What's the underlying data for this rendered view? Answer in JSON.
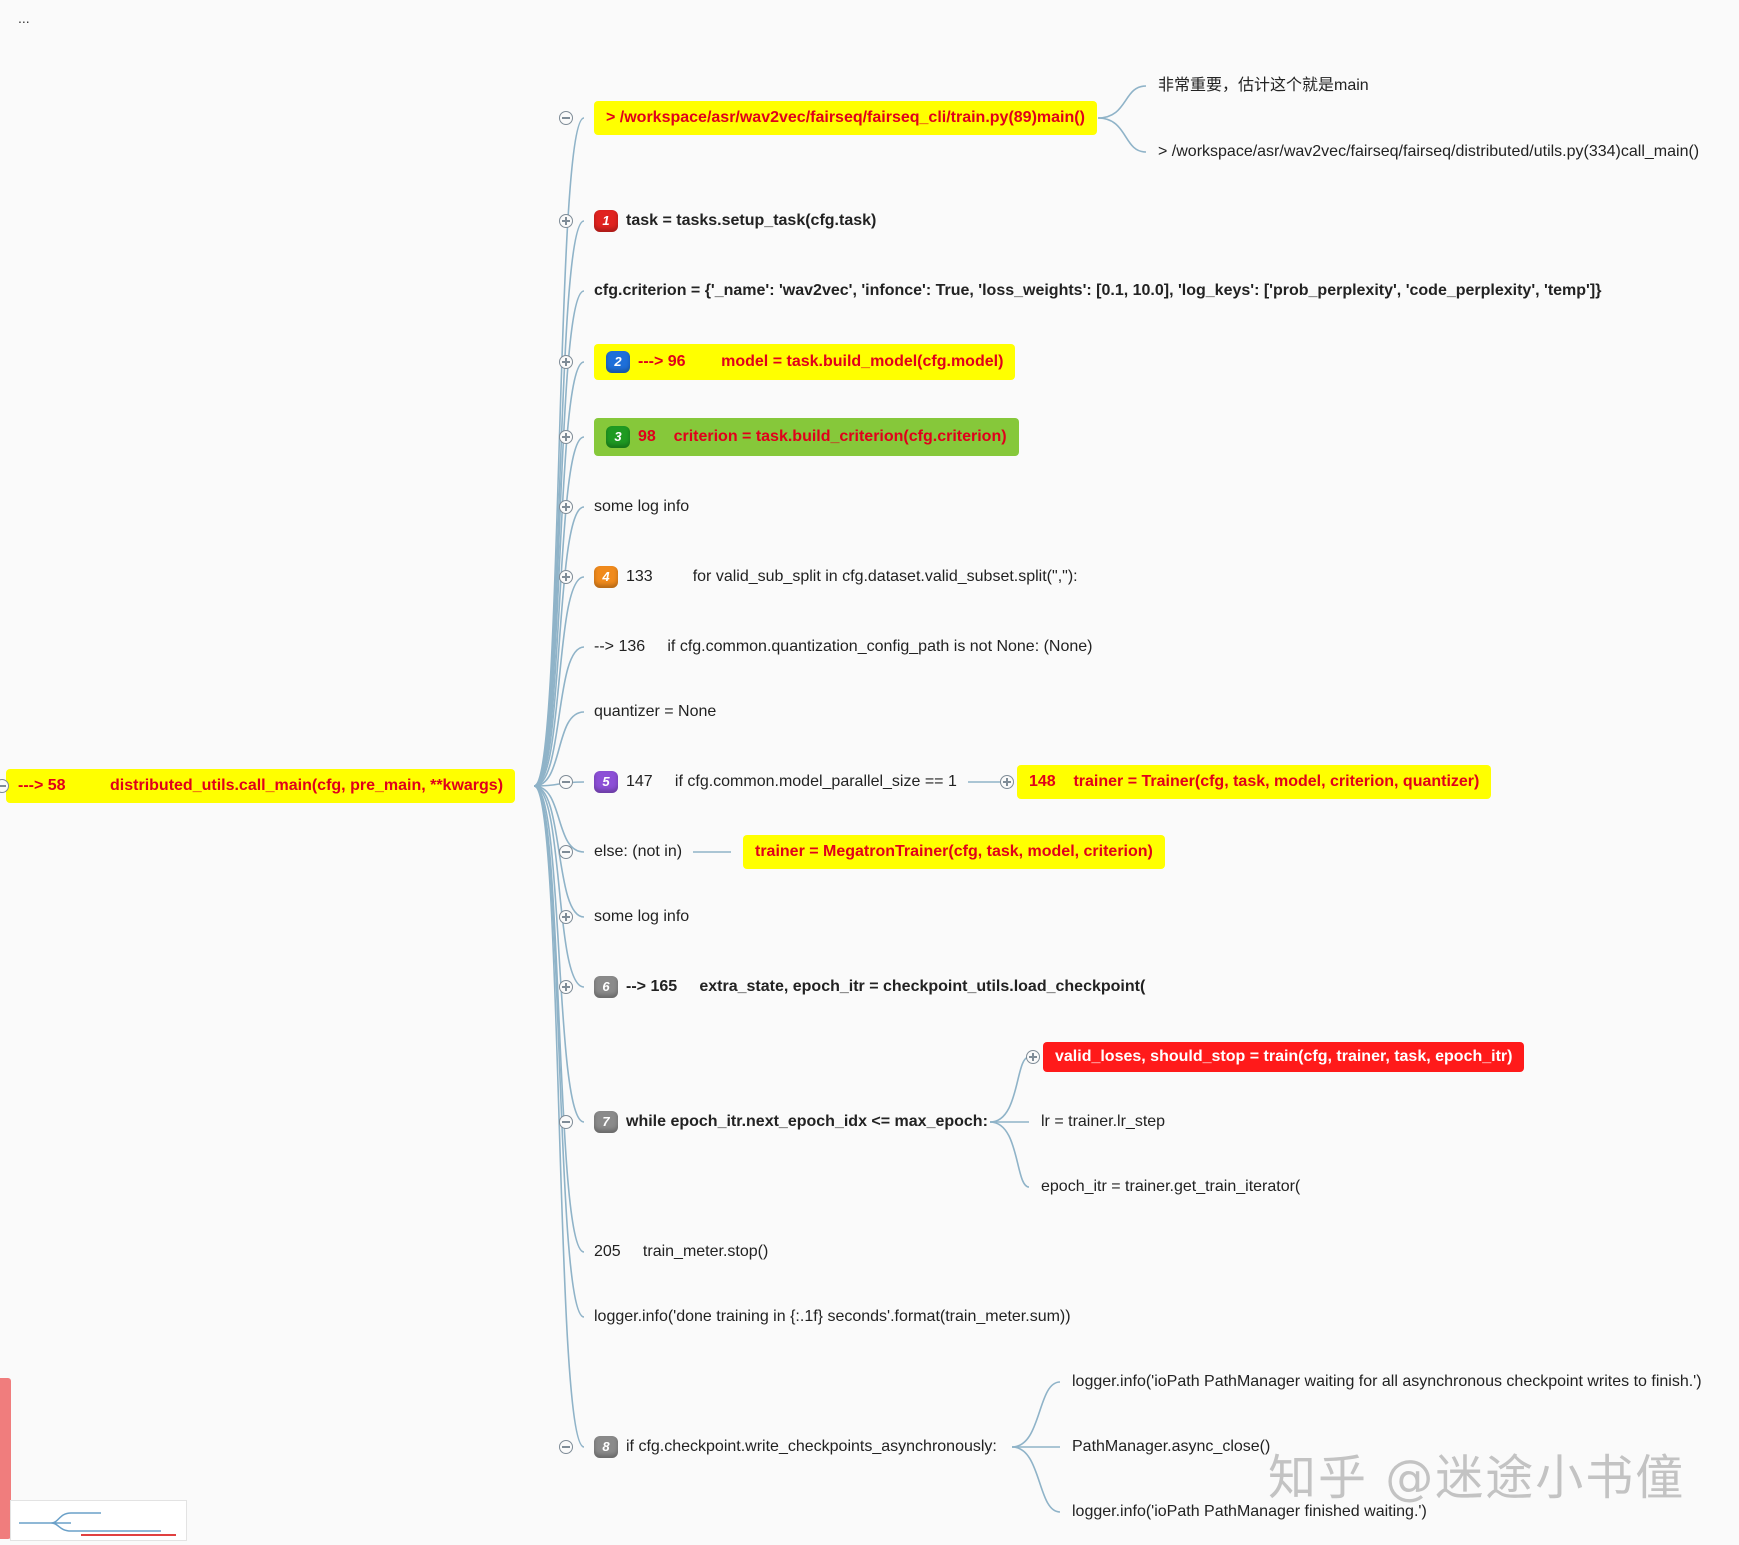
{
  "ellipsis": "...",
  "root": {
    "text": "---> 58          distributed_utils.call_main(cfg, pre_main, **kwargs)"
  },
  "branches": [
    {
      "id": "b0",
      "text": "> /workspace/asr/wav2vec/fairseq/fairseq_cli/train.py(89)main()",
      "style": "yellow",
      "toggle": "minus"
    },
    {
      "id": "b1",
      "badge": "1",
      "badge_color": "#e0231f",
      "text": "task = tasks.setup_task(cfg.task)",
      "style": "bold",
      "toggle": "plus"
    },
    {
      "id": "b2",
      "text": "cfg.criterion = {'_name': 'wav2vec', 'infonce': True, 'loss_weights': [0.1, 10.0], 'log_keys': ['prob_perplexity', 'code_perplexity', 'temp']}",
      "style": "bold",
      "toggle": "none"
    },
    {
      "id": "b3",
      "badge": "2",
      "badge_color": "#1e6fd9",
      "text": "---> 96        model = task.build_model(cfg.model)",
      "style": "yellow",
      "toggle": "plus"
    },
    {
      "id": "b4",
      "badge": "3",
      "badge_color": "#1f9a22",
      "text": "98    criterion = task.build_criterion(cfg.criterion)",
      "style": "green",
      "toggle": "plus"
    },
    {
      "id": "b5",
      "text": "some log info",
      "style": "plain",
      "toggle": "plus"
    },
    {
      "id": "b6",
      "badge": "4",
      "badge_color": "#f08a1c",
      "text": "133         for valid_sub_split in cfg.dataset.valid_subset.split(\",\"):",
      "style": "plain",
      "toggle": "plus"
    },
    {
      "id": "b7",
      "text": "--> 136     if cfg.common.quantization_config_path is not None: (None)",
      "style": "plain",
      "toggle": "none"
    },
    {
      "id": "b8",
      "text": "quantizer = None",
      "style": "plain",
      "toggle": "none"
    },
    {
      "id": "b9",
      "badge": "5",
      "badge_color": "#8c4fd6",
      "text": "147     if cfg.common.model_parallel_size == 1",
      "style": "plain",
      "toggle": "minus"
    },
    {
      "id": "b10",
      "text": "else: (not in)",
      "style": "plain",
      "toggle": "minus"
    },
    {
      "id": "b11",
      "text": "some log info",
      "style": "plain",
      "toggle": "plus"
    },
    {
      "id": "b12",
      "badge": "6",
      "badge_color": "#8a8a8a",
      "text": "--> 165     extra_state, epoch_itr = checkpoint_utils.load_checkpoint(",
      "style": "bold",
      "toggle": "plus"
    },
    {
      "id": "b13",
      "badge": "7",
      "badge_color": "#8a8a8a",
      "text": "while epoch_itr.next_epoch_idx <= max_epoch:",
      "style": "bold",
      "toggle": "minus"
    },
    {
      "id": "b14",
      "text": "205     train_meter.stop()",
      "style": "plain",
      "toggle": "none"
    },
    {
      "id": "b15",
      "text": "logger.info('done training in {:.1f} seconds'.format(train_meter.sum))",
      "style": "plain",
      "toggle": "none"
    },
    {
      "id": "b16",
      "badge": "8",
      "badge_color": "#8a8a8a",
      "text": "if cfg.checkpoint.write_checkpoints_asynchronously:",
      "style": "plain",
      "toggle": "minus"
    }
  ],
  "children": {
    "b0": [
      {
        "text": "非常重要，估计这个就是main",
        "style": "plain"
      },
      {
        "text": "> /workspace/asr/wav2vec/fairseq/fairseq/distributed/utils.py(334)call_main()",
        "style": "plain"
      }
    ],
    "b9": [
      {
        "text": "148    trainer = Trainer(cfg, task, model, criterion, quantizer)",
        "style": "yellow",
        "toggle": "plus"
      }
    ],
    "b10": [
      {
        "text": "trainer = MegatronTrainer(cfg, task, model, criterion)",
        "style": "yellow"
      }
    ],
    "b13": [
      {
        "text": "valid_loses, should_stop = train(cfg, trainer, task, epoch_itr)",
        "style": "red",
        "toggle": "plus"
      },
      {
        "text": "lr = trainer.lr_step",
        "style": "plain"
      },
      {
        "text": "epoch_itr = trainer.get_train_iterator(",
        "style": "plain"
      }
    ],
    "b16": [
      {
        "text": "logger.info('ioPath PathManager waiting for all asynchronous checkpoint writes to finish.')",
        "style": "plain"
      },
      {
        "text": "PathManager.async_close()",
        "style": "plain"
      },
      {
        "text": "logger.info('ioPath PathManager finished waiting.')",
        "style": "plain"
      }
    ]
  },
  "watermark": "知乎 @迷途小书僮",
  "colors": {
    "link": "#8fb3c8",
    "highlight_yellow": "#ffff00",
    "highlight_green": "#86c83a",
    "highlight_red": "#ff1a1a",
    "text_red": "#e0001b"
  }
}
